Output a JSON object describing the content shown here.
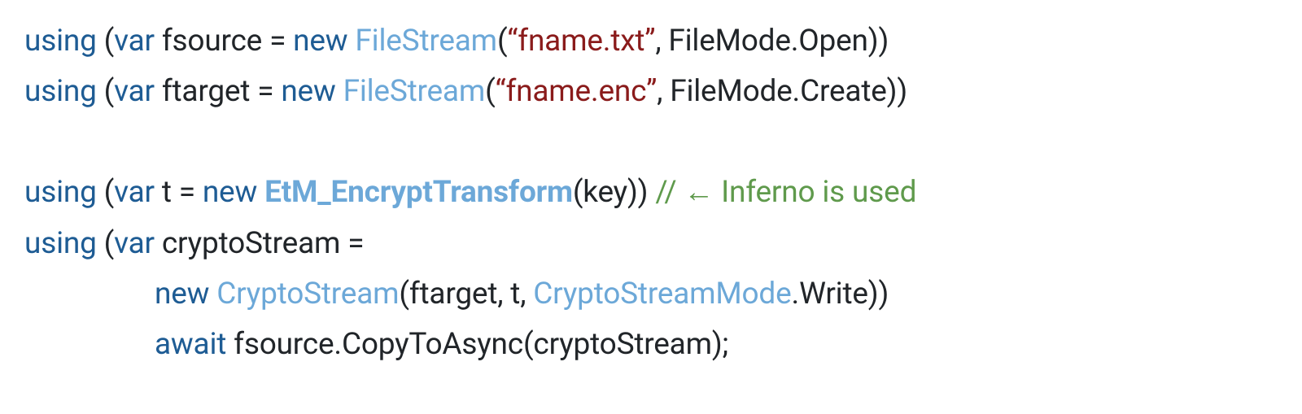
{
  "colors": {
    "keyword": "#1e5c94",
    "type": "#6ca8d8",
    "string": "#8a1b1b",
    "comment": "#5f9a4c",
    "text": "#212529",
    "background": "#ffffff"
  },
  "lines": {
    "l1": {
      "using": "using",
      "p1": " (",
      "var": "var",
      "sp1": " fsource = ",
      "new": "new",
      "sp2": " ",
      "type": "FileStream",
      "p2": "(",
      "str": "“fname.txt”",
      "p3": ", FileMode.Open))"
    },
    "l2": {
      "using": "using",
      "p1": " (",
      "var": "var",
      "sp1": " ftarget = ",
      "new": "new",
      "sp2": " ",
      "type": "FileStream",
      "p2": "(",
      "str": "“fname.enc”",
      "p3": ", FileMode.Create))"
    },
    "l3": {
      "using": "using",
      "p1": " (",
      "var": "var",
      "sp1": " t = ",
      "new": "new",
      "sp2": " ",
      "type": "EtM_EncryptTransform",
      "p3": "(key)) ",
      "cmt": "//  ← Inferno is used"
    },
    "l4": {
      "using": "using",
      "p1": " (",
      "var": "var",
      "sp1": " cryptoStream ="
    },
    "l5": {
      "new": "new",
      "sp2": " ",
      "type": "CryptoStream",
      "p2": "(ftarget, t, ",
      "type2": "CryptoStreamMode",
      "p3": ".Write))"
    },
    "l6": {
      "await": "await",
      "txt": " fsource.CopyToAsync(cryptoStream);"
    }
  }
}
